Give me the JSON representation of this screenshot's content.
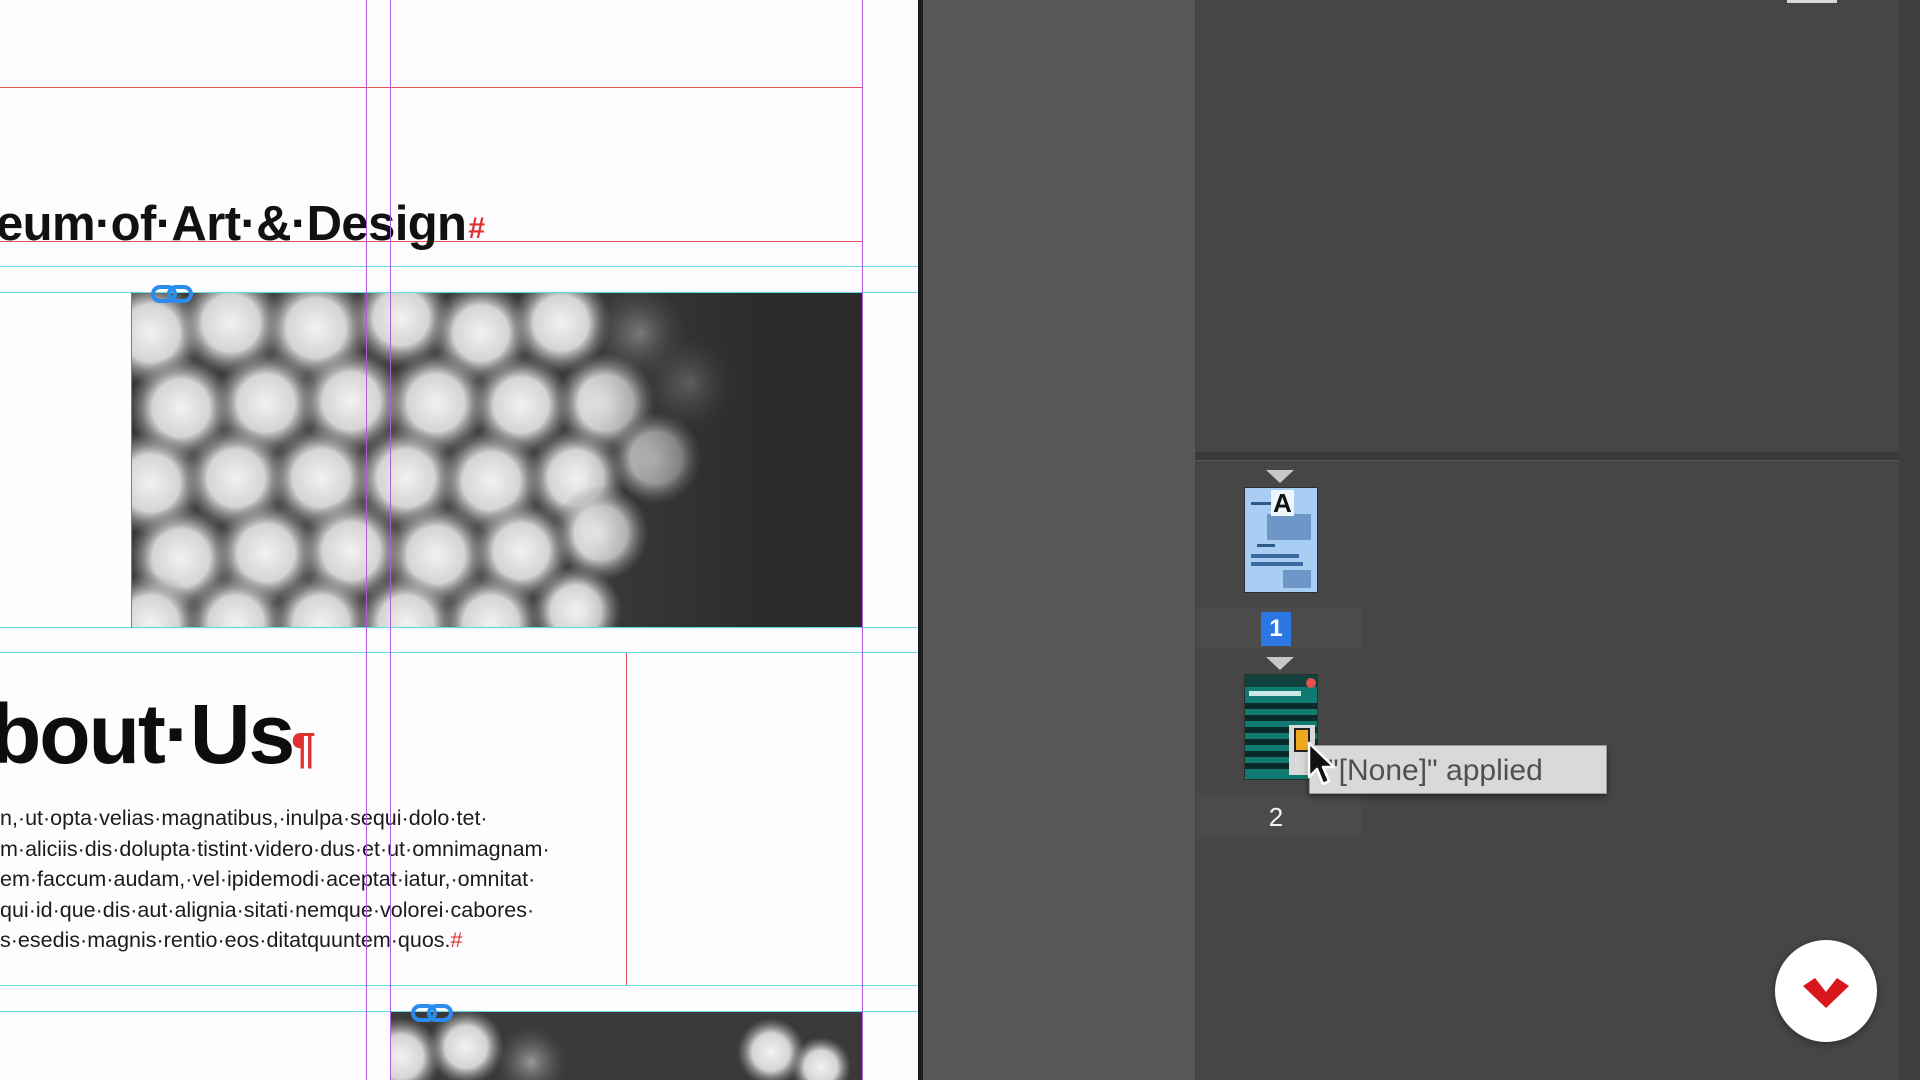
{
  "document": {
    "heading_partial": "eum·of·Art·&·Design",
    "heading_end_mark": "#",
    "section_heading": "bout·Us",
    "section_heading_end_mark": "¶",
    "body_lines": [
      "n,·ut·opta·velias·magnatibus,·inulpa·sequi·dolo·tet·",
      "m·aliciis·dis·dolupta·tistint·videro·dus·et·ut·omnimagnam·",
      "em·faccum·audam,·vel·ipidemodi·aceptat·iatur,·omnitat·",
      "qui·id·que·dis·aut·alignia·sitati·nemque·volorei·cabores·",
      "s·esedis·magnis·rentio·eos·ditatquuntem·quos."
    ],
    "body_end_mark": "#"
  },
  "pages_panel": {
    "parent_page_labels": [
      "A",
      ""
    ],
    "page_numbers": [
      "1",
      "2"
    ],
    "selected_page": "1",
    "tooltip_text": "\"[None]\" applied"
  },
  "icons": {
    "link": "link-icon",
    "cursor": "arrow-cursor-icon",
    "triangle": "parent-page-indicator-icon",
    "fab": "app-logo-icon"
  },
  "colors": {
    "guide_red": "#e2504f",
    "guide_cyan": "#6ad8e2",
    "guide_purple": "#b45ae0",
    "selection_blue": "#2b78e4",
    "panel_bg": "#464646"
  }
}
